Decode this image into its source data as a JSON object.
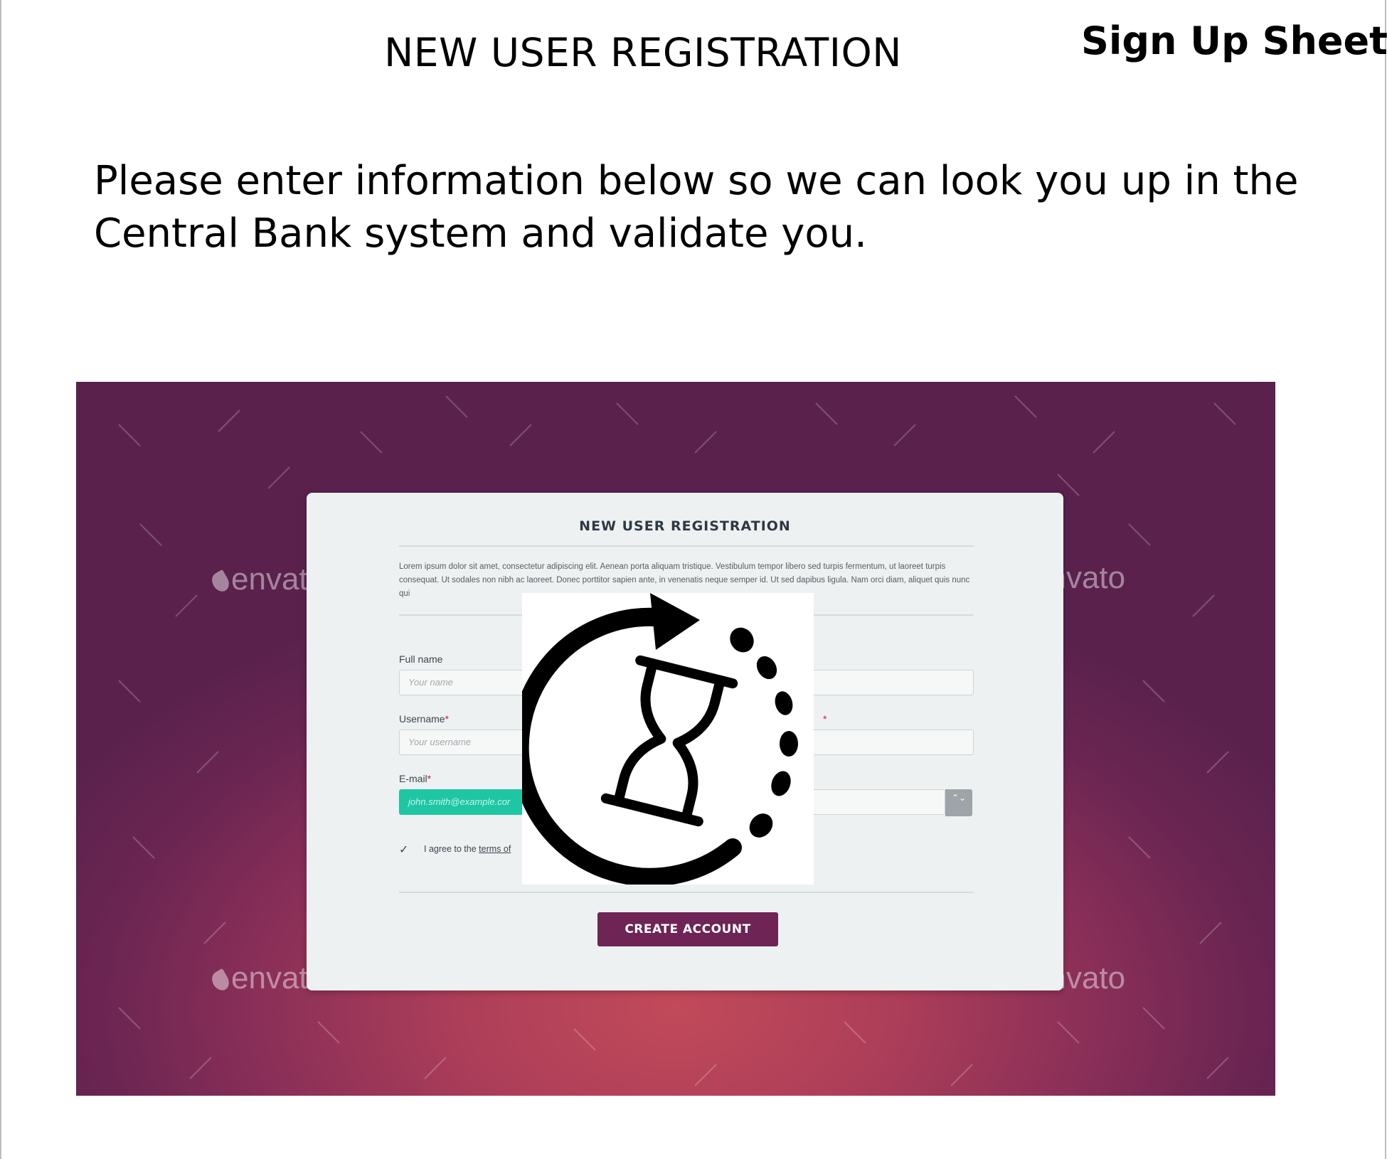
{
  "document": {
    "title": "NEW USER REGISTRATION",
    "sheet_label": "Sign Up Sheet",
    "intro": "Please enter information below so we can look you up in the Central Bank system and validate you."
  },
  "mockup": {
    "watermark_text": "envato",
    "card": {
      "title": "NEW USER REGISTRATION",
      "lorem": "Lorem ipsum dolor sit amet, consectetur adipiscing elit. Aenean porta aliquam tristique. Vestibulum tempor libero sed turpis fermentum, ut laoreet turpis consequat. Ut sodales non nibh ac laoreet. Donec porttitor sapien ante, in venenatis neque semper id. Ut sed dapibus ligula. Nam orci diam, aliquet quis nunc qui",
      "fields": {
        "full_name": {
          "label": "Full name",
          "placeholder": "Your name"
        },
        "username": {
          "label": "Username",
          "required_mark": "*",
          "placeholder": "Your username"
        },
        "email": {
          "label": "E-mail",
          "required_mark": "*",
          "value": "john.smith@example.cor"
        },
        "right_required_mark": "*"
      },
      "agree_prefix": "I agree to the ",
      "agree_link": "terms of",
      "checkbox_glyph": "✓",
      "select_glyph": "⌃⌄",
      "create_button": "CREATE ACCOUNT"
    },
    "overlay_icon": "hourglass-refresh-icon"
  },
  "colors": {
    "mockup_background": "#8a2f58",
    "card_background": "#eef1f2",
    "button": "#6e2454",
    "email_field": "#1ec6a4",
    "required": "#d0163f"
  }
}
